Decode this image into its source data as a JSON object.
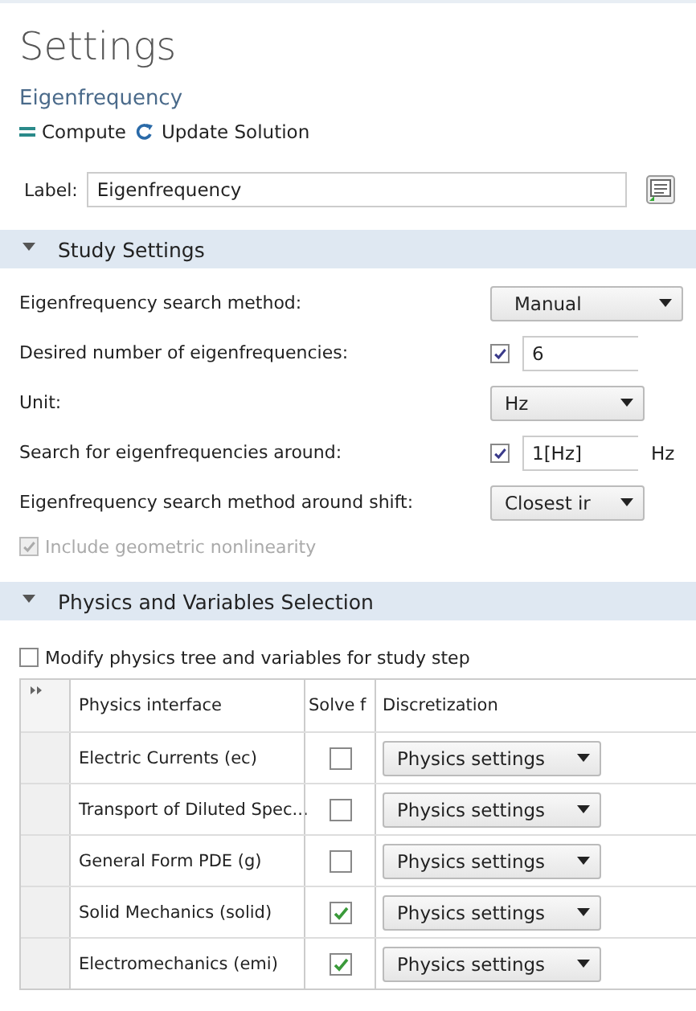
{
  "header": {
    "title": "Settings",
    "subtitle": "Eigenfrequency",
    "actions": [
      {
        "kind": "compute",
        "label": "Compute"
      },
      {
        "kind": "update",
        "label": "Update Solution"
      }
    ]
  },
  "label_field": {
    "label": "Label:",
    "value": "Eigenfrequency"
  },
  "sections": [
    {
      "title": "Study Settings",
      "expanded": true,
      "fields": [
        {
          "kind": "select",
          "label": "Eigenfrequency search method:",
          "value": "Manual",
          "wide": true
        },
        {
          "kind": "check_text",
          "label": "Desired number of eigenfrequencies:",
          "checked": true,
          "value": "6"
        },
        {
          "kind": "select",
          "label": "Unit:",
          "value": "Hz",
          "wide": false
        },
        {
          "kind": "check_text",
          "label": "Search for eigenfrequencies around:",
          "checked": true,
          "value": "1[Hz]",
          "unit": "Hz"
        },
        {
          "kind": "select",
          "label": "Eigenfrequency search method around shift:",
          "value": "Closest ir",
          "wide": false
        },
        {
          "kind": "checkbox",
          "label": "Include geometric nonlinearity",
          "checked": true,
          "disabled": true
        }
      ]
    },
    {
      "title": "Physics and Variables Selection",
      "expanded": true,
      "modify": {
        "label": "Modify physics tree and variables for study step",
        "checked": false
      },
      "table": {
        "columns": [
          "Physics interface",
          "Solve f",
          "Discretization"
        ],
        "rows": [
          {
            "name": "Electric Currents (ec)",
            "solve": false,
            "discretization": "Physics settings"
          },
          {
            "name": "Transport of Diluted Spec...",
            "solve": false,
            "discretization": "Physics settings"
          },
          {
            "name": "General Form PDE (g)",
            "solve": false,
            "discretization": "Physics settings"
          },
          {
            "name": "Solid Mechanics (solid)",
            "solve": true,
            "discretization": "Physics settings"
          },
          {
            "name": "Electromechanics (emi)",
            "solve": true,
            "discretization": "Physics settings"
          }
        ]
      }
    }
  ]
}
